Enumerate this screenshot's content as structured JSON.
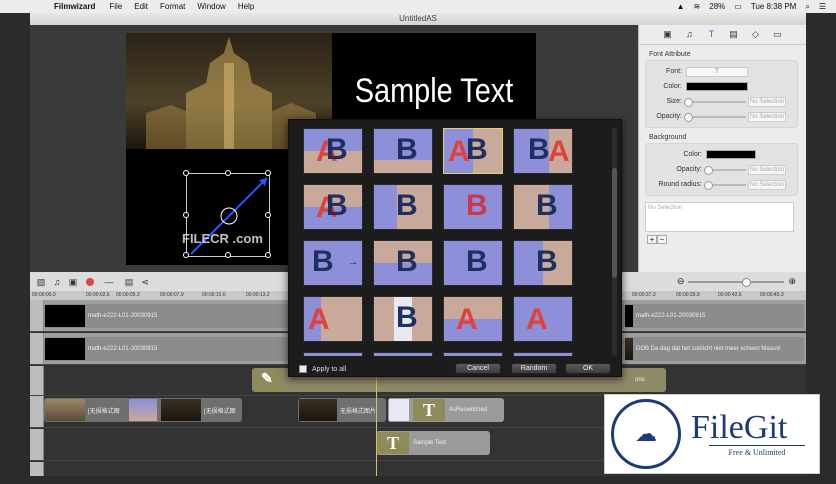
{
  "menubar": {
    "apple": "",
    "app_name": "Filmwizard",
    "items": [
      "File",
      "Edit",
      "Format",
      "Window",
      "Help"
    ],
    "battery": "28%",
    "clock": "Tue 8:38 PM"
  },
  "window": {
    "title": "UntitledAS"
  },
  "preview": {
    "sample_text": "Sample Text",
    "watermark": "FILECR .com"
  },
  "panel": {
    "tabs": [
      "film-icon",
      "music-icon",
      "text-icon",
      "media-icon",
      "shape-icon",
      "folder-icon"
    ],
    "font_attribute_label": "Font Attribute",
    "font_label": "Font:",
    "font_value": "T",
    "color_label": "Color:",
    "size_label": "Size:",
    "opacity_label": "Opacity:",
    "no_selection": "No Selection",
    "background_label": "Background",
    "bg_color_label": "Color:",
    "bg_opacity_label": "Opacity:",
    "round_radius_label": "Round radius:",
    "notes_placeholder": "No Selection",
    "plus": "+",
    "minus": "−"
  },
  "toolbar": {
    "icons": [
      "image-icon",
      "music-note-icon",
      "film-icon",
      "record-icon",
      "minus-icon",
      "save-icon",
      "share-icon"
    ],
    "zoom_out": "⊖",
    "zoom_in": "⊕"
  },
  "ruler": {
    "left_ticks": [
      "00:00:00.0",
      "00:00:02.6",
      "00:00:05.3",
      "00:00:07.9",
      "00:00:10.6",
      "00:00:13.2"
    ],
    "right_ticks": [
      "00:00:37.3",
      "00:00:39.9",
      "00:00:42.6",
      "00:00:45.3"
    ]
  },
  "timeline": {
    "clip1_label": "math-e222-L01-20030915",
    "clip2_label": "math-e222-L01-20030915",
    "clip1_right_label": "math-e222-L01-20030915",
    "clip2_right_label": "DOB Da dag dat het zoelicht niet meer scheen Maasvl",
    "image_clip1": "[无损格式图",
    "image_clip2": "[无损格式图",
    "image_clip3": "无损格式图片",
    "text_clip1": "AsReswitched",
    "text_clip2": "Sample Text",
    "right_fragment": "ons"
  },
  "overlay": {
    "apply_to_all": "Apply to all",
    "cancel": "Cancel",
    "random": "Random",
    "ok": "OK"
  },
  "filegit": {
    "name": "FileGit",
    "tagline": "Free & Unlimited"
  },
  "colors": {
    "accent": "#2a6fd6",
    "record": "#e0443c",
    "playhead": "#d8c25a",
    "filegit": "#1e3a78"
  }
}
